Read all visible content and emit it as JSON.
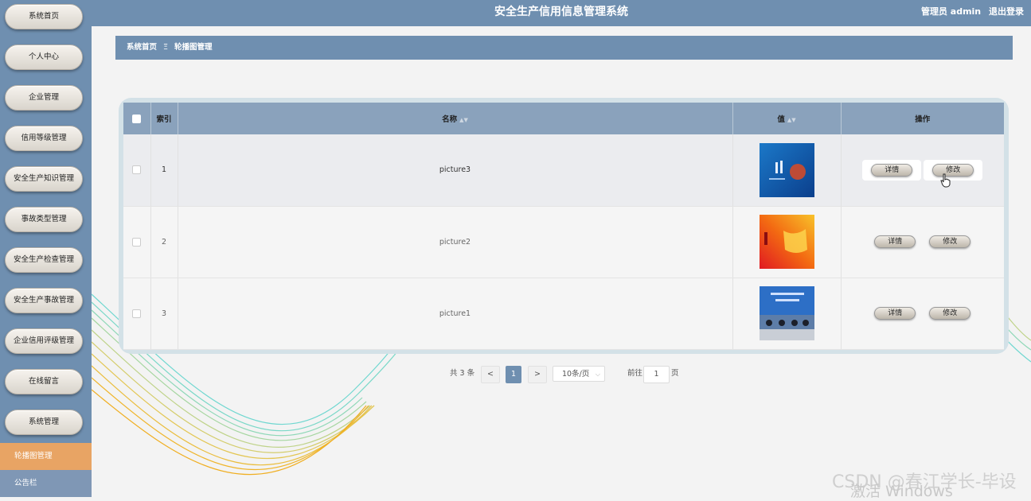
{
  "app": {
    "title": "安全生产信用信息管理系统",
    "user_label": "管理员 admin",
    "logout": "退出登录"
  },
  "sidebar": {
    "items": [
      {
        "label": "系统首页"
      },
      {
        "label": "个人中心"
      },
      {
        "label": "企业管理"
      },
      {
        "label": "信用等级管理"
      },
      {
        "label": "安全生产知识管理"
      },
      {
        "label": "事故类型管理"
      },
      {
        "label": "安全生产检查管理"
      },
      {
        "label": "安全生产事故管理"
      },
      {
        "label": "企业信用评级管理"
      },
      {
        "label": "在线留言"
      },
      {
        "label": "系统管理"
      }
    ],
    "sub_items": [
      {
        "label": "轮播图管理",
        "active": true
      },
      {
        "label": "公告栏",
        "active": false
      }
    ]
  },
  "breadcrumb": {
    "home": "系统首页",
    "separator": "Ξ",
    "current": "轮播图管理"
  },
  "table": {
    "headers": {
      "index": "索引",
      "name": "名称",
      "value": "值",
      "actions": "操作"
    },
    "rows": [
      {
        "index": "1",
        "name": "picture3"
      },
      {
        "index": "2",
        "name": "picture2"
      },
      {
        "index": "3",
        "name": "picture1"
      }
    ],
    "detail_label": "详情",
    "edit_label": "修改"
  },
  "pagination": {
    "total": "共 3 条",
    "prev": "<",
    "current_page": "1",
    "next": ">",
    "page_size": "10条/页",
    "goto_label": "前往",
    "goto_value": "1",
    "page_suffix": "页"
  },
  "watermarks": {
    "csdn": "CSDN @春江学长-毕设",
    "windows": "激活 Windows"
  }
}
